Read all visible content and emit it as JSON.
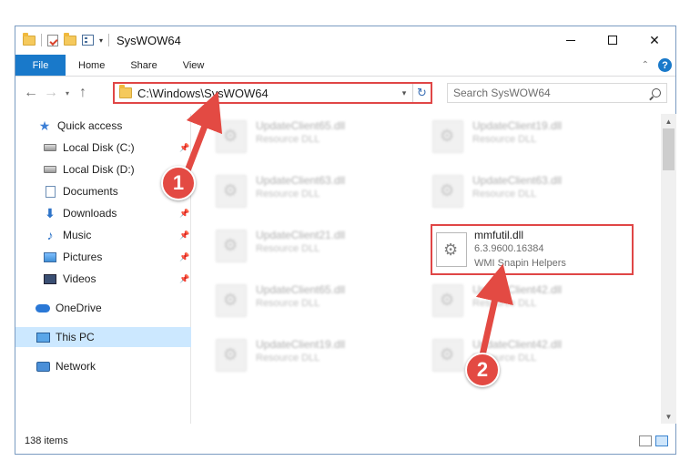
{
  "window": {
    "title": "SysWOW64",
    "qat_caret": "▾"
  },
  "ribbon": {
    "tabs": [
      "File",
      "Home",
      "Share",
      "View"
    ],
    "collapse_glyph": "⌃",
    "help_glyph": "?"
  },
  "controls": {
    "minimize_label": "",
    "close_glyph": "✕"
  },
  "navigation": {
    "back_glyph": "←",
    "forward_glyph": "→",
    "recent_glyph": "▾",
    "up_glyph": "↑"
  },
  "address": {
    "path": "C:\\Windows\\SysWOW64",
    "dropdown_glyph": "▾",
    "refresh_glyph": "↻"
  },
  "search": {
    "placeholder": "Search SysWOW64"
  },
  "sidebar": {
    "items": [
      {
        "label": "Quick access",
        "icon": "star-icon",
        "pinned": false
      },
      {
        "label": "Local Disk (C:)",
        "icon": "drive-icon",
        "pinned": true
      },
      {
        "label": "Local Disk (D:)",
        "icon": "drive-icon",
        "pinned": false
      },
      {
        "label": "Documents",
        "icon": "documents-icon",
        "pinned": true
      },
      {
        "label": "Downloads",
        "icon": "download-icon",
        "pinned": true
      },
      {
        "label": "Music",
        "icon": "music-icon",
        "pinned": true
      },
      {
        "label": "Pictures",
        "icon": "pictures-icon",
        "pinned": true
      },
      {
        "label": "Videos",
        "icon": "videos-icon",
        "pinned": true
      },
      {
        "label": "OneDrive",
        "icon": "onedrive-icon",
        "pinned": false
      },
      {
        "label": "This PC",
        "icon": "this-pc-icon",
        "pinned": false,
        "selected": true
      },
      {
        "label": "Network",
        "icon": "network-icon",
        "pinned": false
      }
    ],
    "pin_glyph": "📌"
  },
  "files": {
    "left_column": [
      {
        "name": "UpdateClient65.dll",
        "type": "Resource DLL"
      },
      {
        "name": "UpdateClient63.dll",
        "type": "Resource DLL"
      },
      {
        "name": "UpdateClient21.dll",
        "type": "Resource DLL"
      },
      {
        "name": "UpdateClient65.dll",
        "type": "Resource DLL"
      },
      {
        "name": "UpdateClient19.dll",
        "type": "Resource DLL"
      }
    ],
    "right_column": [
      {
        "name": "UpdateClient19.dll",
        "type": "Resource DLL"
      },
      {
        "name": "UpdateClient63.dll",
        "type": "Resource DLL"
      },
      {
        "name": "UpdateClient42.dll",
        "type": "Resource DLL"
      },
      {
        "name": "UpdateClient42.dll",
        "type": "Resource DLL"
      }
    ],
    "highlighted": {
      "name": "mmfutil.dll",
      "version": "6.3.9600.16384",
      "description": "WMI Snapin Helpers"
    }
  },
  "scrollbar": {
    "up_glyph": "▲",
    "down_glyph": "▼"
  },
  "status": {
    "item_count": "138 items"
  },
  "callouts": [
    "1",
    "2"
  ],
  "colors": {
    "accent": "#1979ca",
    "highlight_red": "#e04646",
    "callout_red": "#e34a43",
    "selection": "#cce8ff"
  }
}
